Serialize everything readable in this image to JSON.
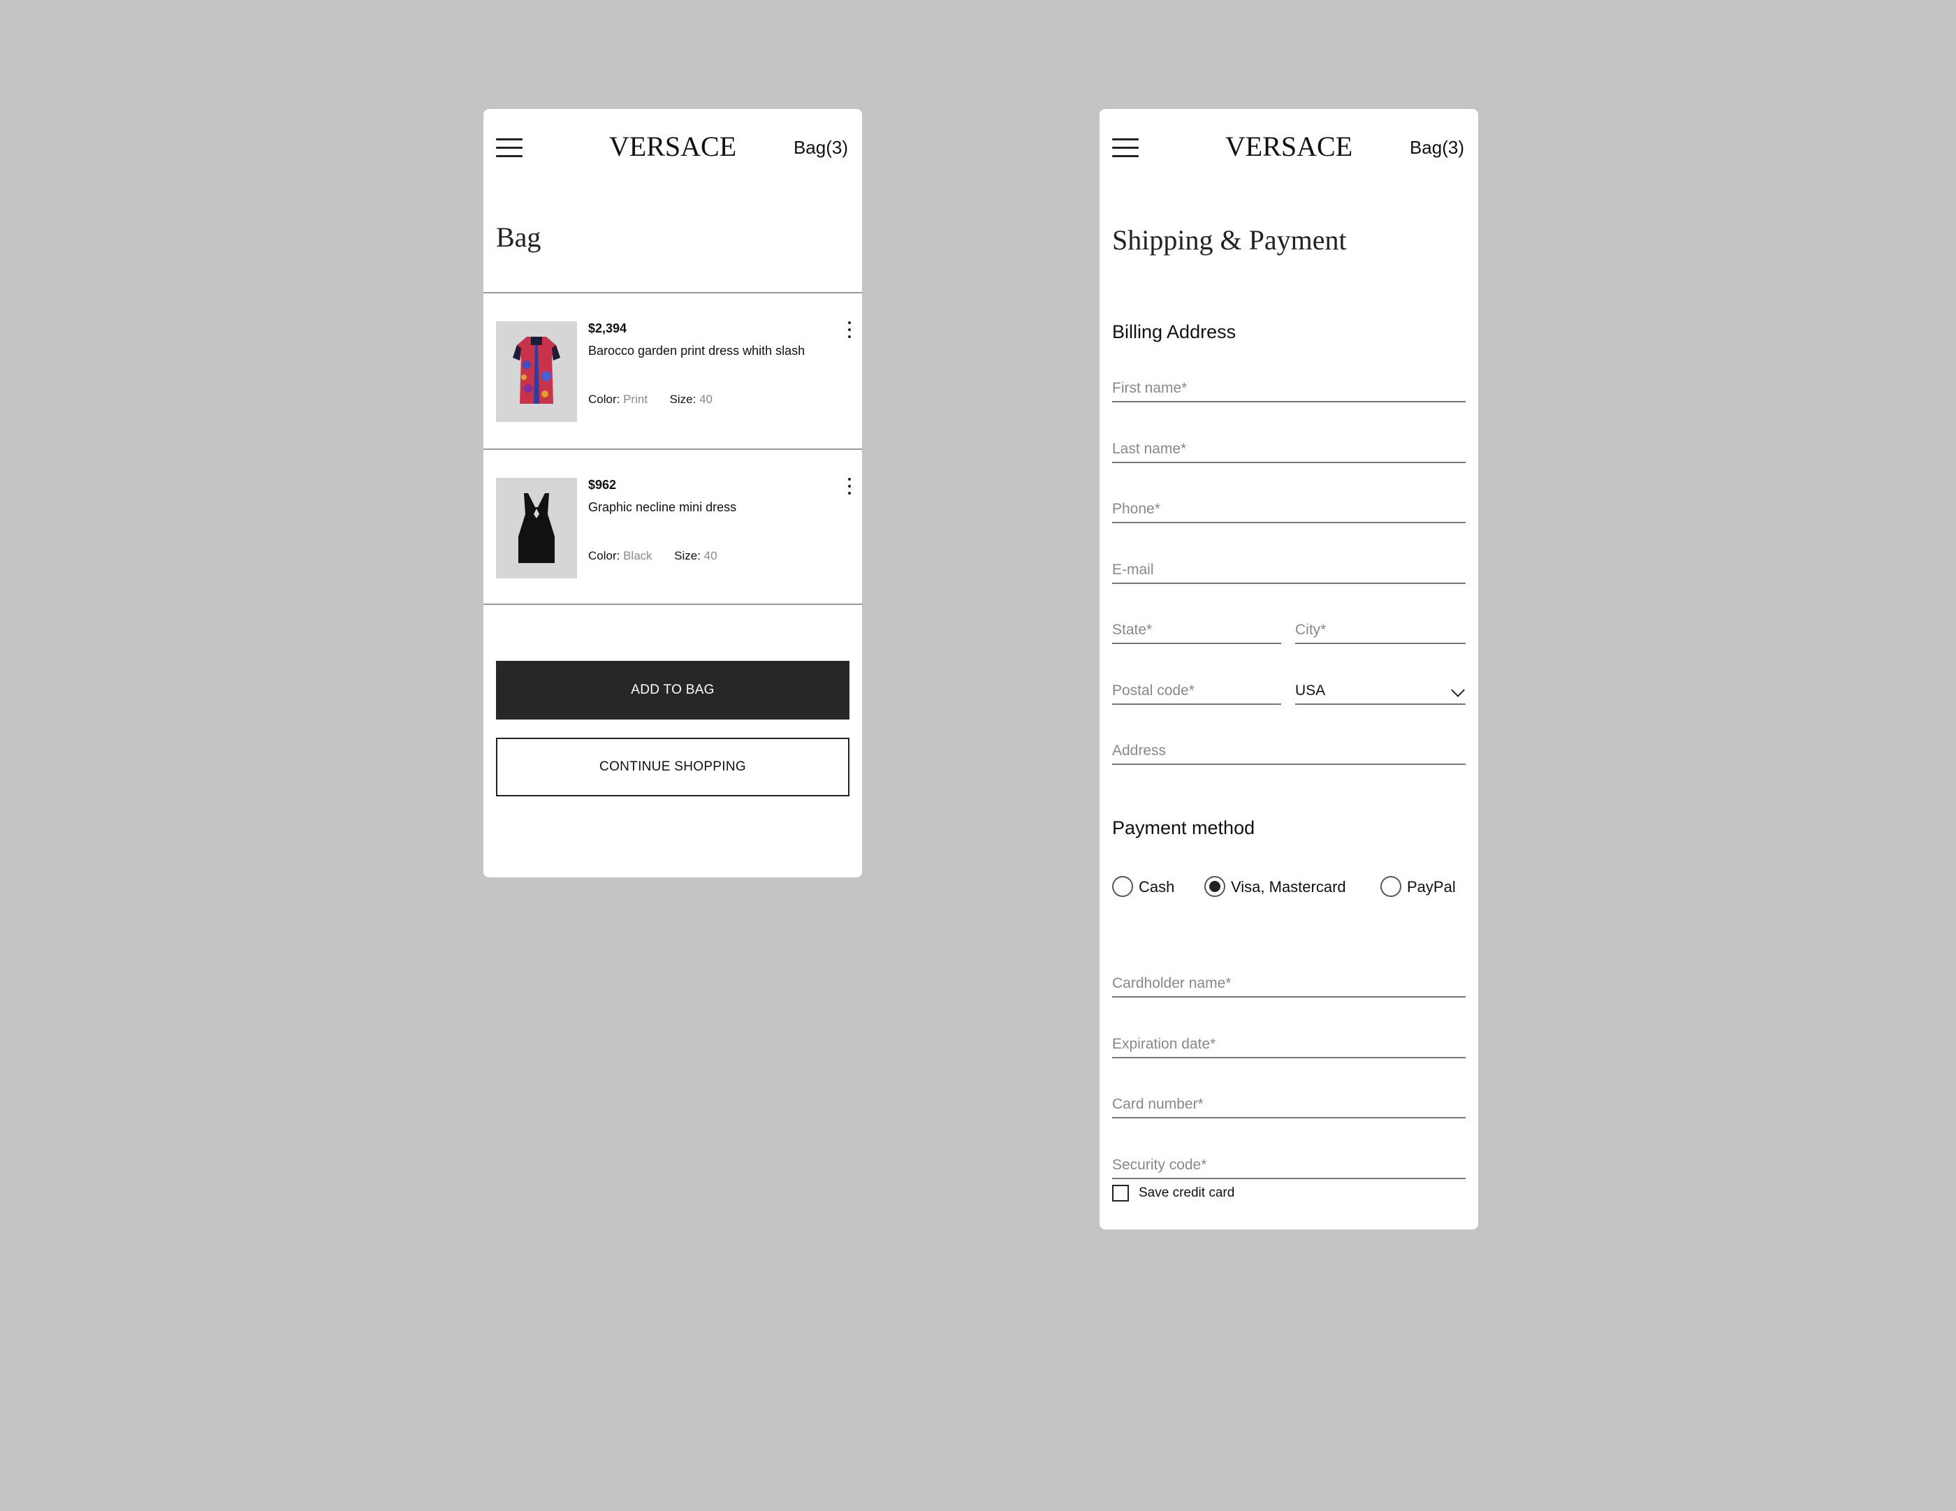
{
  "header": {
    "logo": "VERSACE",
    "bag_label": "Bag(3)"
  },
  "bag": {
    "title": "Bag",
    "items": [
      {
        "price": "$2,394",
        "name": "Barocco garden print dress whith slash",
        "color_label": "Color:",
        "color_value": "Print",
        "size_label": "Size:",
        "size_value": "40"
      },
      {
        "price": "$962",
        "name": "Graphic necline mini dress",
        "color_label": "Color:",
        "color_value": "Black",
        "size_label": "Size:",
        "size_value": "40"
      }
    ],
    "add_button": "ADD TO BAG",
    "continue_button": "CONTINUE SHOPPING"
  },
  "payment": {
    "title": "Shipping & Payment",
    "billing_heading": "Billing Address",
    "fields": {
      "first_name": "First name*",
      "last_name": "Last name*",
      "phone": "Phone*",
      "email": "E-mail",
      "state": "State*",
      "city": "City*",
      "postal": "Postal code*",
      "country": "USA",
      "address": "Address"
    },
    "method_heading": "Payment method",
    "methods": [
      "Cash",
      "Visa, Mastercard",
      "PayPal"
    ],
    "selected_method": "Visa, Mastercard",
    "card_fields": {
      "holder": "Cardholder name*",
      "expiry": "Expiration date*",
      "number": "Card number*",
      "security": "Security code*"
    },
    "save_card_label": "Save credit card",
    "save_card_checked": false
  },
  "colors": {
    "background": "#c4c4c4",
    "primary_button": "#272727",
    "dress_print": "#c8324a",
    "dress_black": "#111111"
  },
  "icons": [
    "menu-icon",
    "more-vertical-icon",
    "chevron-down-icon",
    "radio-icon",
    "checkbox-icon"
  ]
}
